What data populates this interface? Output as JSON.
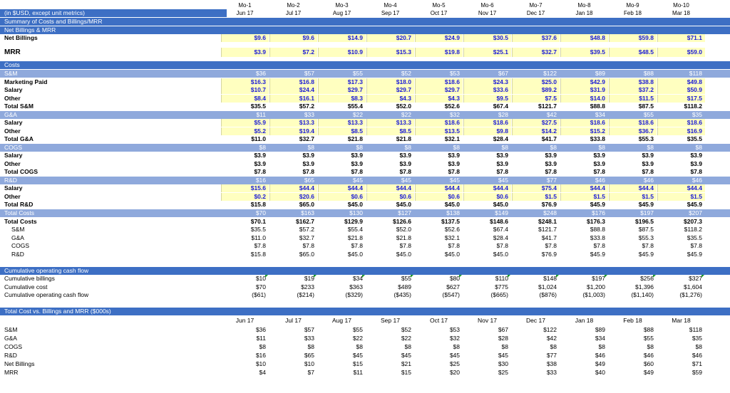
{
  "header": {
    "months": [
      "Mo-1",
      "Mo-2",
      "Mo-3",
      "Mo-4",
      "Mo-5",
      "Mo-6",
      "Mo-7",
      "Mo-8",
      "Mo-9",
      "Mo-10"
    ],
    "dates": [
      "Jun 17",
      "Jul 17",
      "Aug 17",
      "Sep 17",
      "Oct 17",
      "Nov 17",
      "Dec 17",
      "Jan 18",
      "Feb 18",
      "Mar 18"
    ],
    "units_note": "(in $USD, except unit metrics)",
    "summary_title": "Summary of Costs and Billings/MRR"
  },
  "rows": [
    {
      "label": "Net Billings & MRR",
      "style": "band1",
      "values": []
    },
    {
      "label": "Net Billings",
      "style": "bold yel-cells",
      "values": [
        "$9.6",
        "$9.6",
        "$14.9",
        "$20.7",
        "$24.9",
        "$30.5",
        "$37.6",
        "$48.8",
        "$59.8",
        "$71.1"
      ]
    },
    {
      "label": "",
      "style": "spacer",
      "values": []
    },
    {
      "label": "MRR",
      "style": "bold big yel-cells",
      "values": [
        "$3.9",
        "$7.2",
        "$10.9",
        "$15.3",
        "$19.8",
        "$25.1",
        "$32.7",
        "$39.5",
        "$48.5",
        "$59.0"
      ]
    },
    {
      "label": "",
      "style": "spacer",
      "values": []
    },
    {
      "label": "Costs",
      "style": "band1",
      "values": []
    },
    {
      "label": "S&M",
      "style": "band2",
      "values": [
        "$36",
        "$57",
        "$55",
        "$52",
        "$53",
        "$67",
        "$122",
        "$89",
        "$88",
        "$118"
      ]
    },
    {
      "label": "Marketing Paid",
      "style": "bold yel-cells",
      "values": [
        "$16.3",
        "$16.8",
        "$17.3",
        "$18.0",
        "$18.6",
        "$24.3",
        "$25.0",
        "$42.9",
        "$38.8",
        "$49.8"
      ]
    },
    {
      "label": "Salary",
      "style": "bold yel-cells",
      "values": [
        "$10.7",
        "$24.4",
        "$29.7",
        "$29.7",
        "$29.7",
        "$33.6",
        "$89.2",
        "$31.9",
        "$37.2",
        "$50.9"
      ]
    },
    {
      "label": "Other",
      "style": "bold yel-cells",
      "values": [
        "$8.4",
        "$16.1",
        "$8.3",
        "$4.3",
        "$4.3",
        "$9.5",
        "$7.5",
        "$14.0",
        "$11.5",
        "$17.5"
      ]
    },
    {
      "label": "Total S&M",
      "style": "bold",
      "values": [
        "$35.5",
        "$57.2",
        "$55.4",
        "$52.0",
        "$52.6",
        "$67.4",
        "$121.7",
        "$88.8",
        "$87.5",
        "$118.2"
      ]
    },
    {
      "label": "G&A",
      "style": "band2",
      "values": [
        "$11",
        "$33",
        "$22",
        "$22",
        "$32",
        "$28",
        "$42",
        "$34",
        "$55",
        "$35"
      ]
    },
    {
      "label": "Salary",
      "style": "bold yel-cells",
      "values": [
        "$5.9",
        "$13.3",
        "$13.3",
        "$13.3",
        "$18.6",
        "$18.6",
        "$27.5",
        "$18.6",
        "$18.6",
        "$18.6"
      ]
    },
    {
      "label": "Other",
      "style": "bold yel-cells",
      "values": [
        "$5.2",
        "$19.4",
        "$8.5",
        "$8.5",
        "$13.5",
        "$9.8",
        "$14.2",
        "$15.2",
        "$36.7",
        "$16.9"
      ]
    },
    {
      "label": "Total G&A",
      "style": "bold",
      "values": [
        "$11.0",
        "$32.7",
        "$21.8",
        "$21.8",
        "$32.1",
        "$28.4",
        "$41.7",
        "$33.8",
        "$55.3",
        "$35.5"
      ]
    },
    {
      "label": "COGS",
      "style": "band2",
      "values": [
        "$8",
        "$8",
        "$8",
        "$8",
        "$8",
        "$8",
        "$8",
        "$8",
        "$8",
        "$8"
      ]
    },
    {
      "label": "Salary",
      "style": "bold",
      "values": [
        "$3.9",
        "$3.9",
        "$3.9",
        "$3.9",
        "$3.9",
        "$3.9",
        "$3.9",
        "$3.9",
        "$3.9",
        "$3.9"
      ]
    },
    {
      "label": "Other",
      "style": "bold",
      "values": [
        "$3.9",
        "$3.9",
        "$3.9",
        "$3.9",
        "$3.9",
        "$3.9",
        "$3.9",
        "$3.9",
        "$3.9",
        "$3.9"
      ]
    },
    {
      "label": "Total COGS",
      "style": "bold",
      "values": [
        "$7.8",
        "$7.8",
        "$7.8",
        "$7.8",
        "$7.8",
        "$7.8",
        "$7.8",
        "$7.8",
        "$7.8",
        "$7.8"
      ]
    },
    {
      "label": "R&D",
      "style": "band2",
      "values": [
        "$16",
        "$65",
        "$45",
        "$45",
        "$45",
        "$45",
        "$77",
        "$46",
        "$46",
        "$46"
      ]
    },
    {
      "label": "Salary",
      "style": "bold yel-cells",
      "values": [
        "$15.6",
        "$44.4",
        "$44.4",
        "$44.4",
        "$44.4",
        "$44.4",
        "$75.4",
        "$44.4",
        "$44.4",
        "$44.4"
      ]
    },
    {
      "label": "Other",
      "style": "bold yel-cells",
      "values": [
        "$0.2",
        "$20.6",
        "$0.6",
        "$0.6",
        "$0.6",
        "$0.6",
        "$1.5",
        "$1.5",
        "$1.5",
        "$1.5"
      ]
    },
    {
      "label": "Total R&D",
      "style": "bold",
      "values": [
        "$15.8",
        "$65.0",
        "$45.0",
        "$45.0",
        "$45.0",
        "$45.0",
        "$76.9",
        "$45.9",
        "$45.9",
        "$45.9"
      ]
    },
    {
      "label": "Total Costs",
      "style": "band2",
      "values": [
        "$70",
        "$163",
        "$130",
        "$127",
        "$138",
        "$149",
        "$248",
        "$176",
        "$197",
        "$207"
      ]
    },
    {
      "label": "Total Costs",
      "style": "bold",
      "values": [
        "$70.1",
        "$162.7",
        "$129.9",
        "$126.6",
        "$137.5",
        "$148.6",
        "$248.1",
        "$176.3",
        "$196.5",
        "$207.3"
      ]
    },
    {
      "label": "S&M",
      "style": "indent",
      "values": [
        "$35.5",
        "$57.2",
        "$55.4",
        "$52.0",
        "$52.6",
        "$67.4",
        "$121.7",
        "$88.8",
        "$87.5",
        "$118.2"
      ]
    },
    {
      "label": "G&A",
      "style": "indent",
      "values": [
        "$11.0",
        "$32.7",
        "$21.8",
        "$21.8",
        "$32.1",
        "$28.4",
        "$41.7",
        "$33.8",
        "$55.3",
        "$35.5"
      ]
    },
    {
      "label": "COGS",
      "style": "indent",
      "values": [
        "$7.8",
        "$7.8",
        "$7.8",
        "$7.8",
        "$7.8",
        "$7.8",
        "$7.8",
        "$7.8",
        "$7.8",
        "$7.8"
      ]
    },
    {
      "label": "R&D",
      "style": "indent",
      "values": [
        "$15.8",
        "$65.0",
        "$45.0",
        "$45.0",
        "$45.0",
        "$45.0",
        "$76.9",
        "$45.9",
        "$45.9",
        "$45.9"
      ]
    },
    {
      "label": "",
      "style": "spacer",
      "values": []
    },
    {
      "label": "Cumulative operating cash flow",
      "style": "band1",
      "values": []
    },
    {
      "label": "Cumulative billings",
      "style": "flags",
      "values": [
        "$10",
        "$19",
        "$34",
        "$55",
        "$80",
        "$110",
        "$148",
        "$197",
        "$256",
        "$327"
      ]
    },
    {
      "label": "Cumulative cost",
      "style": "",
      "values": [
        "$70",
        "$233",
        "$363",
        "$489",
        "$627",
        "$775",
        "$1,024",
        "$1,200",
        "$1,396",
        "$1,604"
      ]
    },
    {
      "label": "Cumulative operating cash flow",
      "style": "",
      "values": [
        "($61)",
        "($214)",
        "($329)",
        "($435)",
        "($547)",
        "($665)",
        "($876)",
        "($1,003)",
        "($1,140)",
        "($1,276)"
      ]
    },
    {
      "label": "",
      "style": "spacer",
      "values": []
    },
    {
      "label": "Total Cost vs. Billings and MRR ($000s)",
      "style": "band1",
      "values": []
    },
    {
      "label": "",
      "style": "center",
      "values": [
        "Jun 17",
        "Jul 17",
        "Aug 17",
        "Sep 17",
        "Oct 17",
        "Nov 17",
        "Dec 17",
        "Jan 18",
        "Feb 18",
        "Mar 18"
      ]
    },
    {
      "label": "S&M",
      "style": "",
      "values": [
        "$36",
        "$57",
        "$55",
        "$52",
        "$53",
        "$67",
        "$122",
        "$89",
        "$88",
        "$118"
      ]
    },
    {
      "label": "G&A",
      "style": "",
      "values": [
        "$11",
        "$33",
        "$22",
        "$22",
        "$32",
        "$28",
        "$42",
        "$34",
        "$55",
        "$35"
      ]
    },
    {
      "label": "COGS",
      "style": "",
      "values": [
        "$8",
        "$8",
        "$8",
        "$8",
        "$8",
        "$8",
        "$8",
        "$8",
        "$8",
        "$8"
      ]
    },
    {
      "label": "R&D",
      "style": "",
      "values": [
        "$16",
        "$65",
        "$45",
        "$45",
        "$45",
        "$45",
        "$77",
        "$46",
        "$46",
        "$46"
      ]
    },
    {
      "label": "Net Billings",
      "style": "",
      "values": [
        "$10",
        "$10",
        "$15",
        "$21",
        "$25",
        "$30",
        "$38",
        "$49",
        "$60",
        "$71"
      ]
    },
    {
      "label": "MRR",
      "style": "",
      "values": [
        "$4",
        "$7",
        "$11",
        "$15",
        "$20",
        "$25",
        "$33",
        "$40",
        "$49",
        "$59"
      ]
    }
  ]
}
